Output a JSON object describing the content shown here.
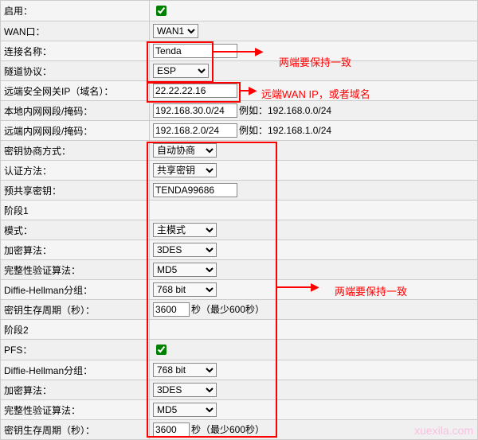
{
  "labels": {
    "enable": "启用：",
    "wan": "WAN口：",
    "conn_name": "连接名称：",
    "tunnel_proto": "隧道协议：",
    "remote_gw": "远端安全网关IP（域名）：",
    "local_net": "本地内网网段/掩码：",
    "remote_net": "远端内网网段/掩码：",
    "key_nego": "密钥协商方式：",
    "auth_method": "认证方法：",
    "psk": "预共享密钥：",
    "phase1": "阶段1",
    "mode": "模式：",
    "enc_algo": "加密算法：",
    "hash_algo": "完整性验证算法：",
    "dh_group": "Diffie-Hellman分组：",
    "key_life": "密钥生存周期（秒）：",
    "phase2": "阶段2",
    "pfs": "PFS：",
    "dh_group2": "Diffie-Hellman分组：",
    "enc_algo2": "加密算法：",
    "hash_algo2": "完整性验证算法：",
    "key_life2": "密钥生存周期（秒）："
  },
  "values": {
    "wan": "WAN1",
    "conn_name": "Tenda",
    "tunnel_proto": "ESP",
    "remote_gw": "22.22.22.16",
    "local_net": "192.168.30.0/24",
    "remote_net": "192.168.2.0/24",
    "key_nego": "自动协商",
    "auth_method": "共享密钥",
    "psk": "TENDA99686",
    "mode": "主模式",
    "enc_algo": "3DES",
    "hash_algo": "MD5",
    "dh_group": "768 bit",
    "key_life": "3600",
    "dh_group2": "768 bit",
    "enc_algo2": "3DES",
    "hash_algo2": "MD5",
    "key_life2": "3600"
  },
  "hints": {
    "local_net": "例如：192.168.0.0/24",
    "remote_net": "例如：192.168.1.0/24",
    "key_life": "秒（最少600秒）",
    "key_life2": "秒（最少600秒）"
  },
  "annotations": {
    "both_sides": "两端要保持一致",
    "remote_wan": "远端WAN IP，或者域名"
  },
  "watermark": "xuexila.com"
}
